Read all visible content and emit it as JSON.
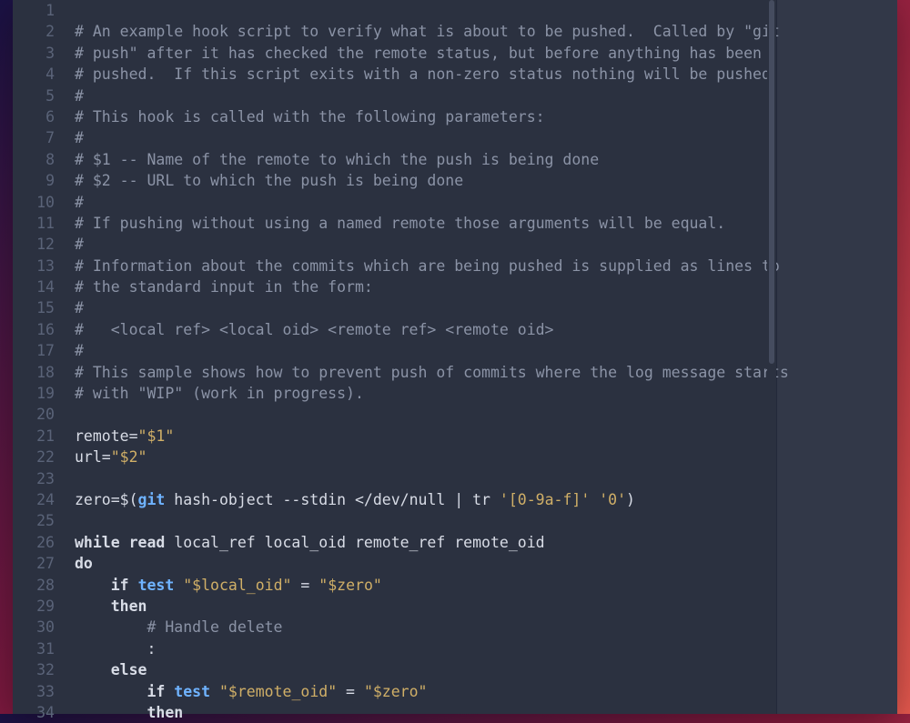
{
  "editor": {
    "first_line_number": 1,
    "lines": [
      [],
      [
        {
          "cls": "c-comment",
          "t": "# An example hook script to verify what is about to be pushed.  Called by \"git"
        }
      ],
      [
        {
          "cls": "c-comment",
          "t": "# push\" after it has checked the remote status, but before anything has been"
        }
      ],
      [
        {
          "cls": "c-comment",
          "t": "# pushed.  If this script exits with a non-zero status nothing will be pushed."
        }
      ],
      [
        {
          "cls": "c-comment",
          "t": "#"
        }
      ],
      [
        {
          "cls": "c-comment",
          "t": "# This hook is called with the following parameters:"
        }
      ],
      [
        {
          "cls": "c-comment",
          "t": "#"
        }
      ],
      [
        {
          "cls": "c-comment",
          "t": "# $1 -- Name of the remote to which the push is being done"
        }
      ],
      [
        {
          "cls": "c-comment",
          "t": "# $2 -- URL to which the push is being done"
        }
      ],
      [
        {
          "cls": "c-comment",
          "t": "#"
        }
      ],
      [
        {
          "cls": "c-comment",
          "t": "# If pushing without using a named remote those arguments will be equal."
        }
      ],
      [
        {
          "cls": "c-comment",
          "t": "#"
        }
      ],
      [
        {
          "cls": "c-comment",
          "t": "# Information about the commits which are being pushed is supplied as lines to"
        }
      ],
      [
        {
          "cls": "c-comment",
          "t": "# the standard input in the form:"
        }
      ],
      [
        {
          "cls": "c-comment",
          "t": "#"
        }
      ],
      [
        {
          "cls": "c-comment",
          "t": "#   <local ref> <local oid> <remote ref> <remote oid>"
        }
      ],
      [
        {
          "cls": "c-comment",
          "t": "#"
        }
      ],
      [
        {
          "cls": "c-comment",
          "t": "# This sample shows how to prevent push of commits where the log message starts"
        }
      ],
      [
        {
          "cls": "c-comment",
          "t": "# with \"WIP\" (work in progress)."
        }
      ],
      [],
      [
        {
          "cls": "c-default",
          "t": "remote="
        },
        {
          "cls": "c-string",
          "t": "\"$1\""
        }
      ],
      [
        {
          "cls": "c-default",
          "t": "url="
        },
        {
          "cls": "c-string",
          "t": "\"$2\""
        }
      ],
      [],
      [
        {
          "cls": "c-default",
          "t": "zero=$("
        },
        {
          "cls": "c-cmd",
          "t": "git"
        },
        {
          "cls": "c-default",
          "t": " hash-object --stdin </dev/null | tr "
        },
        {
          "cls": "c-string",
          "t": "'[0-9a-f]'"
        },
        {
          "cls": "c-default",
          "t": " "
        },
        {
          "cls": "c-string",
          "t": "'0'"
        },
        {
          "cls": "c-default",
          "t": ")"
        }
      ],
      [],
      [
        {
          "cls": "c-keyword",
          "t": "while read"
        },
        {
          "cls": "c-default",
          "t": " local_ref local_oid remote_ref remote_oid"
        }
      ],
      [
        {
          "cls": "c-keyword",
          "t": "do"
        }
      ],
      [
        {
          "cls": "c-default",
          "t": "    "
        },
        {
          "cls": "c-keyword",
          "t": "if"
        },
        {
          "cls": "c-default",
          "t": " "
        },
        {
          "cls": "c-cmd",
          "t": "test"
        },
        {
          "cls": "c-default",
          "t": " "
        },
        {
          "cls": "c-string",
          "t": "\"$local_oid\""
        },
        {
          "cls": "c-default",
          "t": " = "
        },
        {
          "cls": "c-string",
          "t": "\"$zero\""
        }
      ],
      [
        {
          "cls": "c-default",
          "t": "    "
        },
        {
          "cls": "c-keyword",
          "t": "then"
        }
      ],
      [
        {
          "cls": "c-default",
          "t": "        "
        },
        {
          "cls": "c-comment",
          "t": "# Handle delete"
        }
      ],
      [
        {
          "cls": "c-default",
          "t": "        :"
        }
      ],
      [
        {
          "cls": "c-default",
          "t": "    "
        },
        {
          "cls": "c-keyword",
          "t": "else"
        }
      ],
      [
        {
          "cls": "c-default",
          "t": "        "
        },
        {
          "cls": "c-keyword",
          "t": "if"
        },
        {
          "cls": "c-default",
          "t": " "
        },
        {
          "cls": "c-cmd",
          "t": "test"
        },
        {
          "cls": "c-default",
          "t": " "
        },
        {
          "cls": "c-string",
          "t": "\"$remote_oid\""
        },
        {
          "cls": "c-default",
          "t": " = "
        },
        {
          "cls": "c-string",
          "t": "\"$zero\""
        }
      ],
      [
        {
          "cls": "c-default",
          "t": "        "
        },
        {
          "cls": "c-keyword",
          "t": "then"
        }
      ]
    ]
  },
  "scrollbar": {
    "visible": true
  }
}
